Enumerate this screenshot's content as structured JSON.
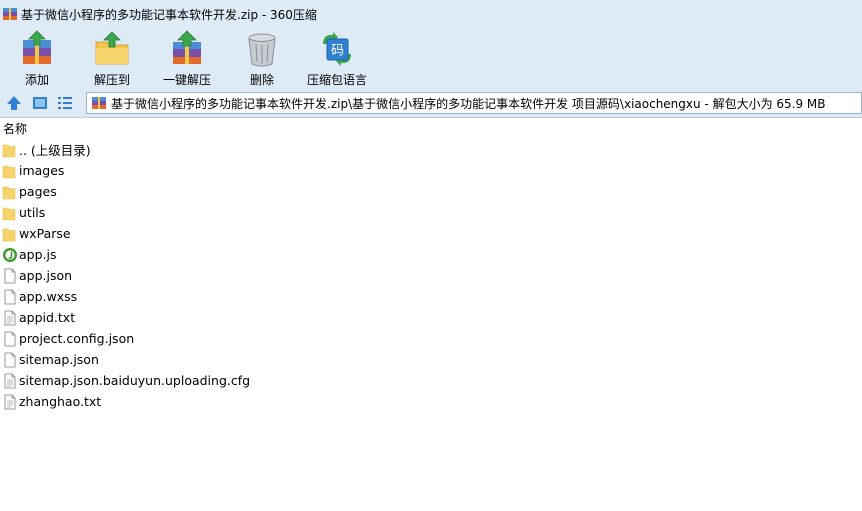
{
  "window": {
    "title": "基于微信小程序的多功能记事本软件开发.zip - 360压缩"
  },
  "toolbar": {
    "add_label": "添加",
    "extract_to_label": "解压到",
    "one_click_extract_label": "一键解压",
    "delete_label": "删除",
    "archive_language_label": "压缩包语言",
    "language_icon_char": "码"
  },
  "address": {
    "path": "基于微信小程序的多功能记事本软件开发.zip\\基于微信小程序的多功能记事本软件开发 项目源码\\xiaochengxu - 解包大小为 65.9 MB"
  },
  "columns": {
    "name": "名称"
  },
  "files": [
    {
      "name": ".. (上级目录)",
      "icon": "folder-icon"
    },
    {
      "name": "images",
      "icon": "folder-icon"
    },
    {
      "name": "pages",
      "icon": "folder-icon"
    },
    {
      "name": "utils",
      "icon": "folder-icon"
    },
    {
      "name": "wxParse",
      "icon": "folder-icon"
    },
    {
      "name": "app.js",
      "icon": "js-file-icon"
    },
    {
      "name": "app.json",
      "icon": "file-icon"
    },
    {
      "name": "app.wxss",
      "icon": "file-icon"
    },
    {
      "name": "appid.txt",
      "icon": "text-file-icon"
    },
    {
      "name": "project.config.json",
      "icon": "file-icon"
    },
    {
      "name": "sitemap.json",
      "icon": "file-icon"
    },
    {
      "name": "sitemap.json.baiduyun.uploading.cfg",
      "icon": "text-file-icon"
    },
    {
      "name": "zhanghao.txt",
      "icon": "text-file-icon"
    }
  ],
  "colors": {
    "chrome": "#dfeaf7",
    "folder": "#f7d46b",
    "js_icon": "#3f9a2e",
    "nav_blue": "#2f7fd4"
  }
}
